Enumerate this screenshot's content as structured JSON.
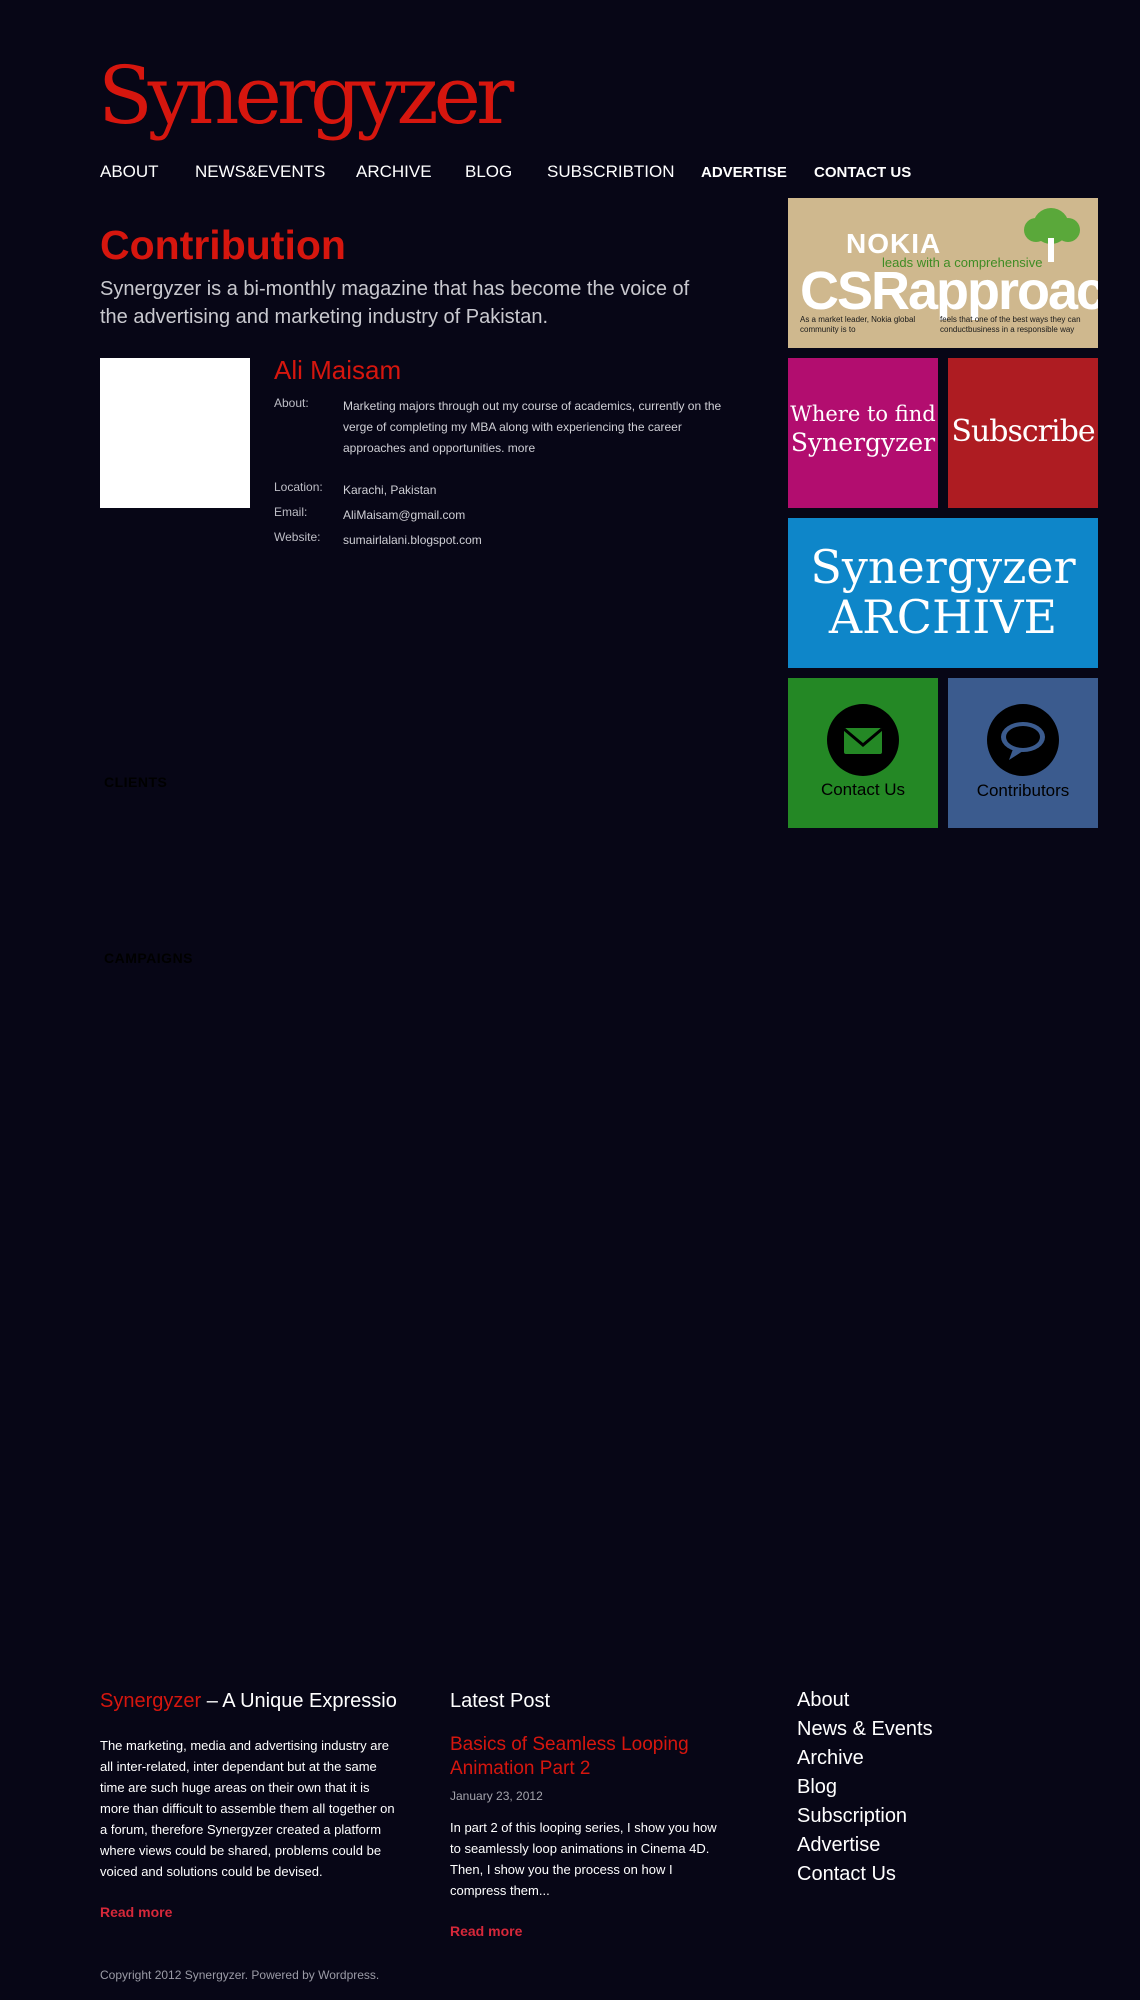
{
  "site": {
    "logo": "Synergyzer"
  },
  "nav": {
    "items": [
      "ABOUT",
      "NEWS&EVENTS",
      "ARCHIVE",
      "BLOG",
      "SUBSCRIBTION",
      "ADVERTISE",
      "CONTACT US"
    ]
  },
  "main": {
    "title": "Contribution",
    "intro": "Synergyzer is a bi-monthly magazine that has become the voice of the advertising and marketing industry of Pakistan.",
    "author": {
      "name": "Ali Maisam",
      "about_label": "About:",
      "about": "Marketing majors through out my course of academics, currently on the verge of completing my MBA along with experiencing the career approaches and opportunities. more",
      "location_label": "Location:",
      "location": "Karachi, Pakistan",
      "email_label": "Email:",
      "email": "AliMaisam@gmail.com",
      "website_label": "Website:",
      "website": "sumairlalani.blogspot.com"
    },
    "clients_heading": "CLIENTS",
    "campaigns_heading": "CAMPAIGNS"
  },
  "sidebar": {
    "ad": {
      "brand": "NOKIA",
      "tagline": "leads with a comprehensive",
      "headline": "CSRapproach",
      "text_left": "As a market leader, Nokia global community is to",
      "text_right": "feels that one of the best ways they can conductbusiness in a responsible way"
    },
    "where_to_find": [
      "Where to find",
      "Synergyzer"
    ],
    "subscribe": "Subscribe",
    "archive": [
      "Synergyzer",
      "ARCHIVE"
    ],
    "contact": "Contact Us",
    "contributors": "Contributors"
  },
  "footer": {
    "about": {
      "title_brand": "Synergyzer",
      "title_rest": " – A Unique Expressio",
      "body": "The marketing, media and advertising industry are all inter-related, inter dependant but at the same time are such huge areas on their own that it is more than difficult to assemble them all together on a forum, therefore Synergyzer created a platform where views could be shared, problems could be voiced and solutions could be devised.",
      "read_more": "Read more"
    },
    "latest": {
      "title": "Latest Post",
      "post_title": "Basics of Seamless Looping Animation Part 2",
      "date": "January 23, 2012",
      "excerpt": "In part 2 of this looping series, I show you how to seamlessly loop animations in Cinema 4D. Then, I show you the process on how I compress them...",
      "read_more": "Read more"
    },
    "links": [
      "About",
      "News & Events",
      "Archive",
      "Blog",
      "Subscription",
      "Advertise",
      "Contact Us"
    ],
    "copyright": "Copyright 2012 Synergyzer. Powered by Wordpress."
  },
  "colors": {
    "background": "#070616",
    "accent_red": "#d6160e",
    "tile_magenta": "#b20d6f",
    "tile_red": "#ae1c22",
    "tile_blue": "#0e86c9",
    "tile_green": "#248825",
    "tile_slate": "#3b5b8e"
  },
  "icons": {
    "contact": "envelope-icon",
    "contributors": "speech-bubble-icon"
  }
}
